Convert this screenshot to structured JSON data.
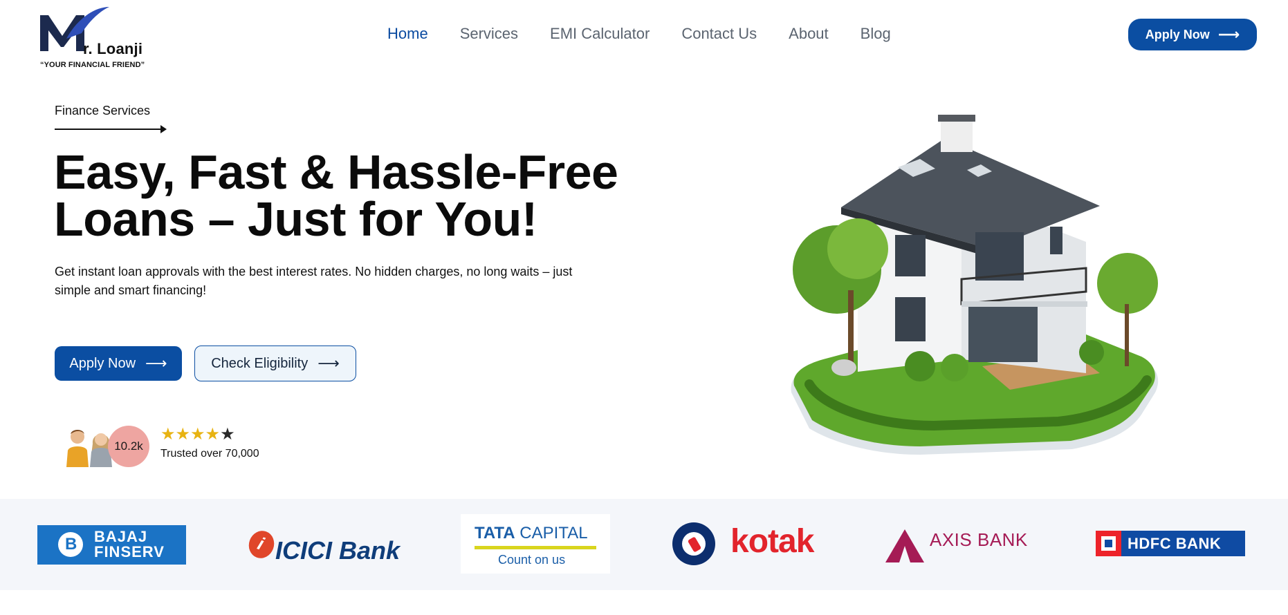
{
  "brand": {
    "name": "r. Loanji",
    "tagline": "“YOUR FINANCIAL FRIEND”",
    "primary_color": "#0b4ea2",
    "logo_mark_color": "#1c2a4e"
  },
  "nav": {
    "items": [
      {
        "label": "Home",
        "active": true
      },
      {
        "label": "Services",
        "active": false
      },
      {
        "label": "EMI Calculator",
        "active": false
      },
      {
        "label": "Contact Us",
        "active": false
      },
      {
        "label": "About",
        "active": false
      },
      {
        "label": "Blog",
        "active": false
      }
    ],
    "cta_label": "Apply Now"
  },
  "hero": {
    "eyebrow": "Finance Services",
    "title_line1": "Easy, Fast & Hassle-Free",
    "title_line2": "Loans – Just for You!",
    "subtitle": "Get instant loan approvals with the best interest rates. No hidden charges, no long waits – just simple and smart financing!",
    "primary_button": "Apply Now",
    "secondary_button": "Check Eligibility",
    "image_icon": "house-illustration"
  },
  "trust": {
    "count": "10.2k",
    "rating": 4,
    "rating_max": 5,
    "text": "Trusted over 70,000",
    "star_color": "#e8b312"
  },
  "banks": {
    "bajaj": "BAJAJ\nFINSERV",
    "icici": "ICICI Bank",
    "tata_line1": "TATA",
    "tata_line1b": " CAPITAL",
    "tata_line2": "Count on us",
    "kotak": "kotak",
    "axis": "AXIS BANK",
    "hdfc": "HDFC BANK"
  }
}
